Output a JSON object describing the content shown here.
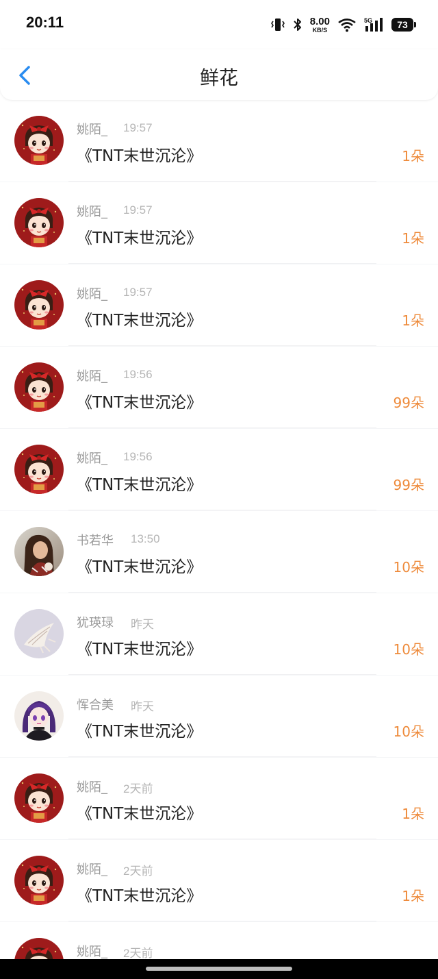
{
  "status_bar": {
    "time": "20:11",
    "speed_value": "8.00",
    "speed_unit": "KB/S",
    "network": "5G",
    "battery": "73"
  },
  "header": {
    "title": "鲜花",
    "back_icon": "chevron-left-icon"
  },
  "colors": {
    "accent_blue": "#2a8cf0",
    "count_orange": "#ee8a3a"
  },
  "records": [
    {
      "user": "姚陌_",
      "time": "19:57",
      "book": "《TNT末世沉沦》",
      "count": "1朵",
      "avatar": "red-girl-avatar"
    },
    {
      "user": "姚陌_",
      "time": "19:57",
      "book": "《TNT末世沉沦》",
      "count": "1朵",
      "avatar": "red-girl-avatar"
    },
    {
      "user": "姚陌_",
      "time": "19:57",
      "book": "《TNT末世沉沦》",
      "count": "1朵",
      "avatar": "red-girl-avatar"
    },
    {
      "user": "姚陌_",
      "time": "19:56",
      "book": "《TNT末世沉沦》",
      "count": "99朵",
      "avatar": "red-girl-avatar"
    },
    {
      "user": "姚陌_",
      "time": "19:56",
      "book": "《TNT末世沉沦》",
      "count": "99朵",
      "avatar": "red-girl-avatar"
    },
    {
      "user": "书若华",
      "time": "13:50",
      "book": "《TNT末世沉沦》",
      "count": "10朵",
      "avatar": "photo-woman-avatar"
    },
    {
      "user": "犹瑛琭",
      "time": "昨天",
      "book": "《TNT末世沉沦》",
      "count": "10朵",
      "avatar": "seashell-avatar"
    },
    {
      "user": "恽合美",
      "time": "昨天",
      "book": "《TNT末世沉沦》",
      "count": "10朵",
      "avatar": "anime-girl-avatar"
    },
    {
      "user": "姚陌_",
      "time": "2天前",
      "book": "《TNT末世沉沦》",
      "count": "1朵",
      "avatar": "red-girl-avatar"
    },
    {
      "user": "姚陌_",
      "time": "2天前",
      "book": "《TNT末世沉沦》",
      "count": "1朵",
      "avatar": "red-girl-avatar"
    },
    {
      "user": "姚陌_",
      "time": "2天前",
      "book": "",
      "count": "",
      "avatar": "red-girl-avatar"
    }
  ]
}
